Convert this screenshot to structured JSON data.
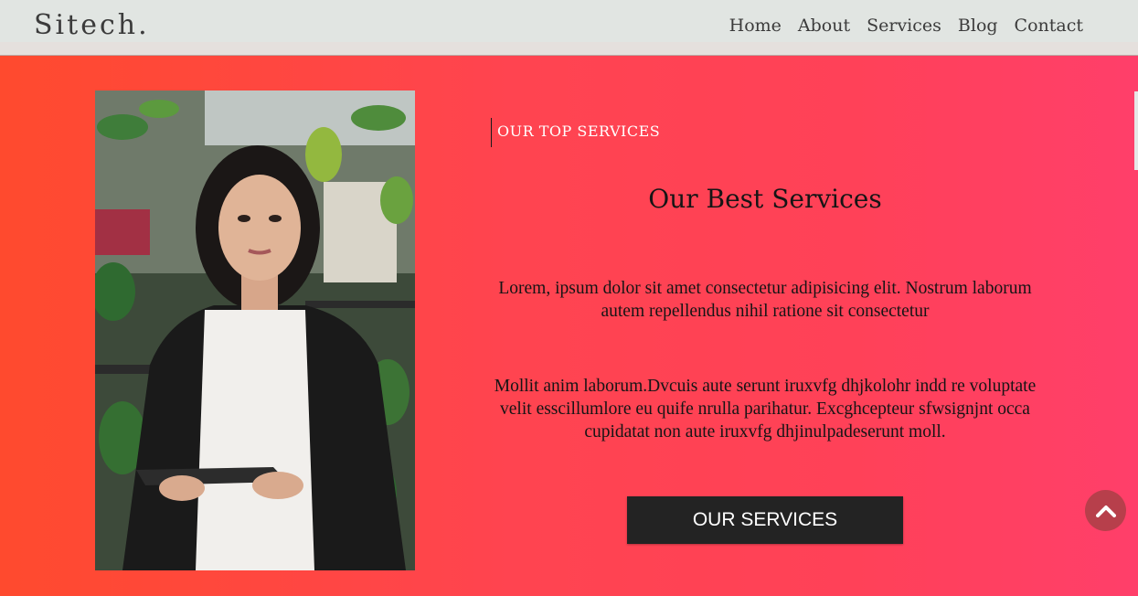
{
  "brand": {
    "logo": "Sitech."
  },
  "nav": {
    "items": [
      "Home",
      "About",
      "Services",
      "Blog",
      "Contact"
    ]
  },
  "hero": {
    "eyebrow": "OUR TOP SERVICES",
    "heading": "Our Best Services",
    "para1": "Lorem, ipsum dolor sit amet consectetur adipisicing elit. Nostrum laborum autem repellendus nihil ratione sit consectetur",
    "para2": "Mollit anim laborum.Dvcuis aute serunt iruxvfg dhjkolohr indd re voluptate velit esscillumlore eu quife nrulla parihatur. Excghcepteur sfwsignjnt occa cupidatat non aute iruxvfg dhjinulpadeserunt moll.",
    "cta": "OUR SERVICES"
  },
  "colors": {
    "accent_start": "#ff4a2e",
    "accent_end": "#ff3f6a",
    "button_dark": "#232323",
    "scroll_top_bg": "#b73f4b"
  },
  "icons": {
    "scroll_top": "chevron-up-icon"
  }
}
